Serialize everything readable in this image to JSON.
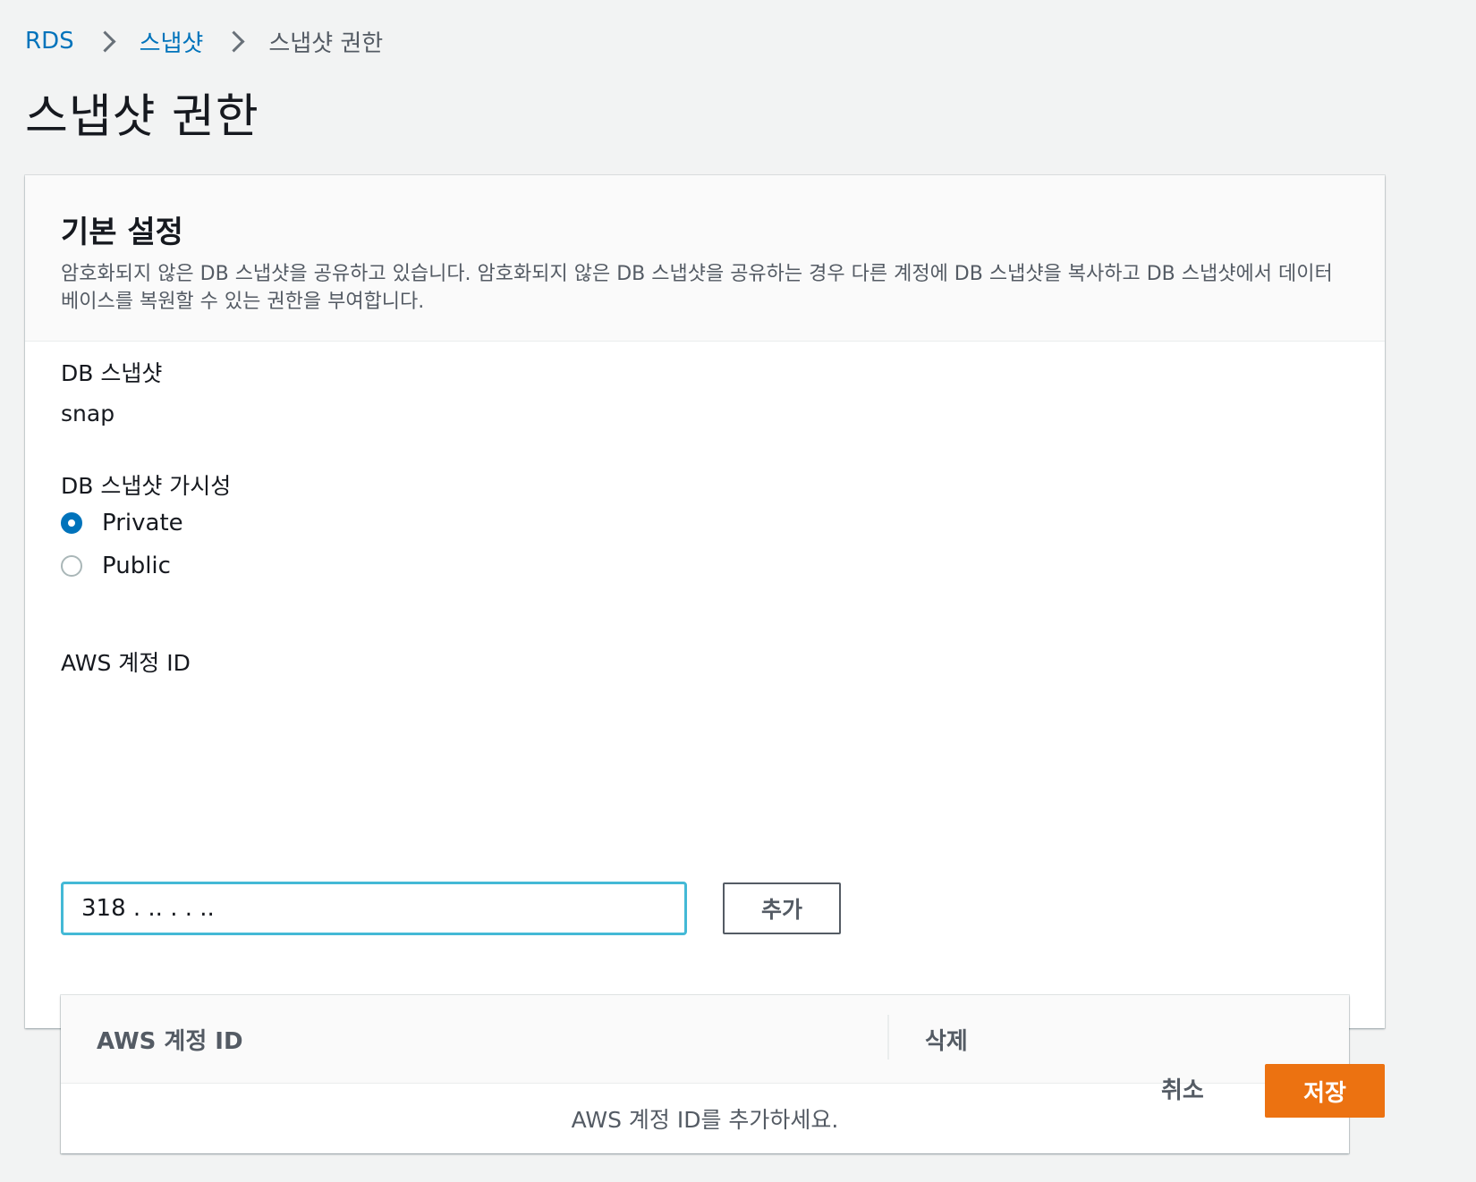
{
  "breadcrumb": {
    "items": [
      {
        "label": "RDS"
      },
      {
        "label": "스냅샷"
      },
      {
        "label": "스냅샷 권한"
      }
    ]
  },
  "page": {
    "title": "스냅샷 권한"
  },
  "panel": {
    "title": "기본 설정",
    "description": "암호화되지 않은 DB 스냅샷을 공유하고 있습니다. 암호화되지 않은 DB 스냅샷을 공유하는 경우 다른 계정에 DB 스냅샷을 복사하고 DB 스냅샷에서 데이터베이스를 복원할 수 있는 권한을 부여합니다."
  },
  "snapshot": {
    "label": "DB 스냅샷",
    "value": "snap"
  },
  "visibility": {
    "label": "DB 스냅샷 가시성",
    "options": [
      {
        "label": "Private",
        "selected": true
      },
      {
        "label": "Public",
        "selected": false
      }
    ]
  },
  "account": {
    "label": "AWS 계정 ID",
    "input_value": "318 . .. . . ..",
    "add_label": "추가"
  },
  "table": {
    "columns": [
      "AWS 계정 ID",
      "삭제"
    ],
    "empty_text": "AWS 계정 ID를 추가하세요."
  },
  "actions": {
    "cancel_label": "취소",
    "save_label": "저장"
  },
  "colors": {
    "link": "#0073bb",
    "primary": "#ec7211",
    "focus": "#44b9d6",
    "radio_selected": "#0073bb"
  }
}
